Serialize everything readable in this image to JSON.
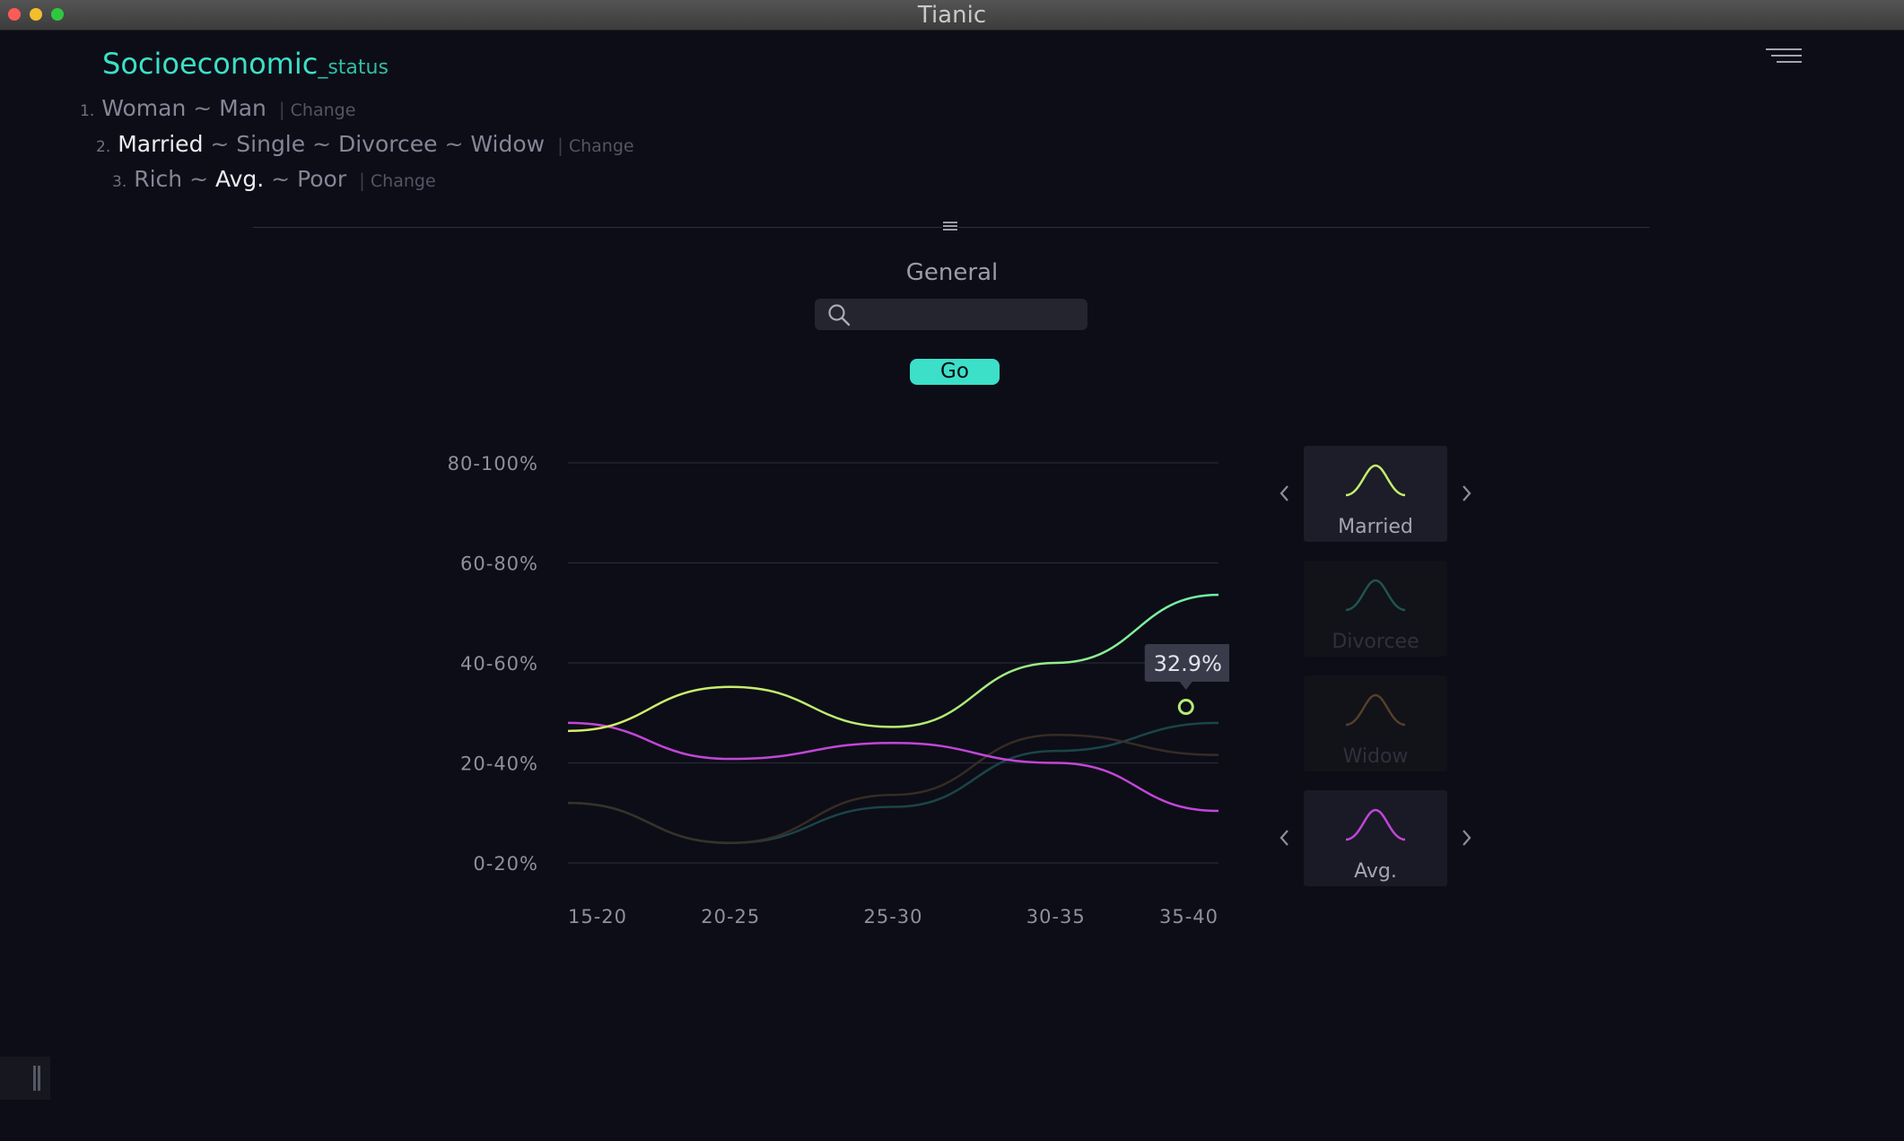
{
  "window": {
    "title": "Tianic"
  },
  "heading": {
    "main": "Socioeconomic",
    "sub": "_status"
  },
  "options": [
    {
      "num": "1.",
      "items": [
        "Woman",
        "Man"
      ],
      "selected": -1,
      "change": "Change"
    },
    {
      "num": "2.",
      "items": [
        "Married",
        "Single",
        "Divorcee",
        "Widow"
      ],
      "selected": 0,
      "change": "Change"
    },
    {
      "num": "3.",
      "items": [
        "Rich",
        "Avg.",
        "Poor"
      ],
      "selected": 1,
      "change": "Change"
    }
  ],
  "section": {
    "title": "General"
  },
  "search": {
    "value": "",
    "placeholder": ""
  },
  "go_button": {
    "label": "Go"
  },
  "chart_data": {
    "type": "line",
    "categories": [
      "15-20",
      "20-25",
      "25-30",
      "30-35",
      "35-40"
    ],
    "y_ticks": [
      "0-20%",
      "20-40%",
      "40-60%",
      "60-80%",
      "80-100%"
    ],
    "ylim": [
      0,
      100
    ],
    "grid": true,
    "series": [
      {
        "name": "Married",
        "color": "#d0f070",
        "color_end": "#6cf0a8",
        "opacity": 1,
        "values": [
          33,
          44,
          34,
          50,
          67
        ]
      },
      {
        "name": "Divorcee",
        "color": "#1c4b4e",
        "opacity": 0.9,
        "values": [
          15,
          5,
          14,
          28,
          35
        ]
      },
      {
        "name": "Widow",
        "color": "#3b3026",
        "opacity": 0.9,
        "values": [
          15,
          5,
          17,
          32,
          27
        ]
      },
      {
        "name": "Avg.",
        "color": "#c246d8",
        "opacity": 1,
        "values": [
          35,
          26,
          30,
          25,
          13
        ]
      }
    ],
    "tooltip": {
      "series": "Married",
      "x": 3.8,
      "value": 39,
      "label": "32.9%"
    }
  },
  "legend": [
    {
      "name": "Married",
      "color": "#c3ee6c",
      "label_color": "#a3a5b0",
      "bg": "#1c1d28"
    },
    {
      "name": "Divorcee",
      "color": "#1f5550",
      "label_color": "#2f313b",
      "bg": "#121219"
    },
    {
      "name": "Widow",
      "color": "#55402a",
      "label_color": "#2f313b",
      "bg": "#121219"
    },
    {
      "name": "Avg.",
      "color": "#c246d8",
      "label_color": "#a3a5b0",
      "bg": "#1a1a26"
    }
  ]
}
